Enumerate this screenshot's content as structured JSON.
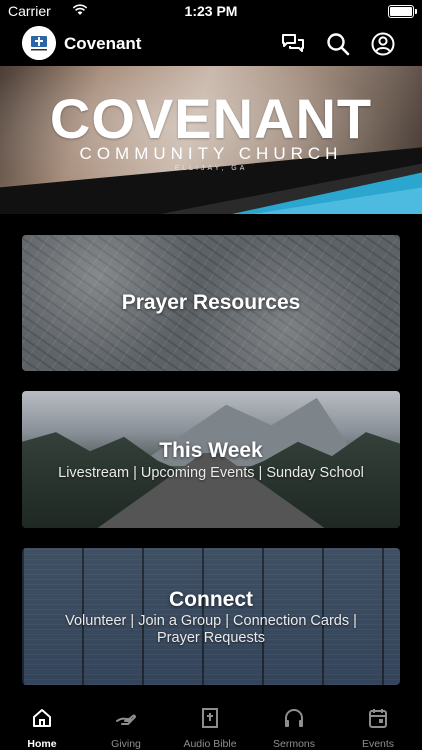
{
  "status_bar": {
    "carrier": "Carrier",
    "time": "1:23 PM"
  },
  "header": {
    "title": "Covenant",
    "icons": [
      "chat-icon",
      "search-icon",
      "account-icon"
    ]
  },
  "banner": {
    "title": "COVENANT",
    "subtitle": "COMMUNITY CHURCH",
    "location": "ELLIJAY, GA",
    "accent_color": "#2aa6cf"
  },
  "cards": [
    {
      "title": "Prayer Resources",
      "subtitle": ""
    },
    {
      "title": "This Week",
      "subtitle": "Livestream | Upcoming Events | Sunday School"
    },
    {
      "title": "Connect",
      "subtitle_line1": "Volunteer | Join a Group | Connection Cards |",
      "subtitle_line2": "Prayer Requests"
    }
  ],
  "tabs": [
    {
      "label": "Home",
      "icon": "home-icon",
      "active": true
    },
    {
      "label": "Giving",
      "icon": "giving-icon",
      "active": false
    },
    {
      "label": "Audio Bible",
      "icon": "bible-icon",
      "active": false
    },
    {
      "label": "Sermons",
      "icon": "headphones-icon",
      "active": false
    },
    {
      "label": "Events",
      "icon": "calendar-icon",
      "active": false
    }
  ]
}
